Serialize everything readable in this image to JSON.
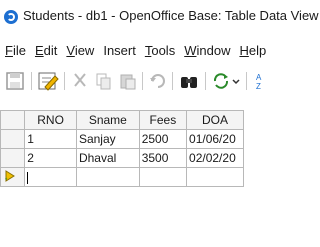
{
  "window": {
    "title": "Students - db1 - OpenOffice Base: Table Data View"
  },
  "menubar": {
    "file": "File",
    "edit": "Edit",
    "view": "View",
    "insert": "Insert",
    "tools": "Tools",
    "window": "Window",
    "help": "Help"
  },
  "table": {
    "columns": [
      "RNO",
      "Sname",
      "Fees",
      "DOA"
    ],
    "rows": [
      [
        "1",
        "Sanjay",
        "2500",
        "01/06/20"
      ],
      [
        "2",
        "Dhaval",
        "3500",
        "02/02/20"
      ]
    ]
  },
  "colors": {
    "accent": "#1d6fd1",
    "grid_border": "#b8b8b8"
  }
}
